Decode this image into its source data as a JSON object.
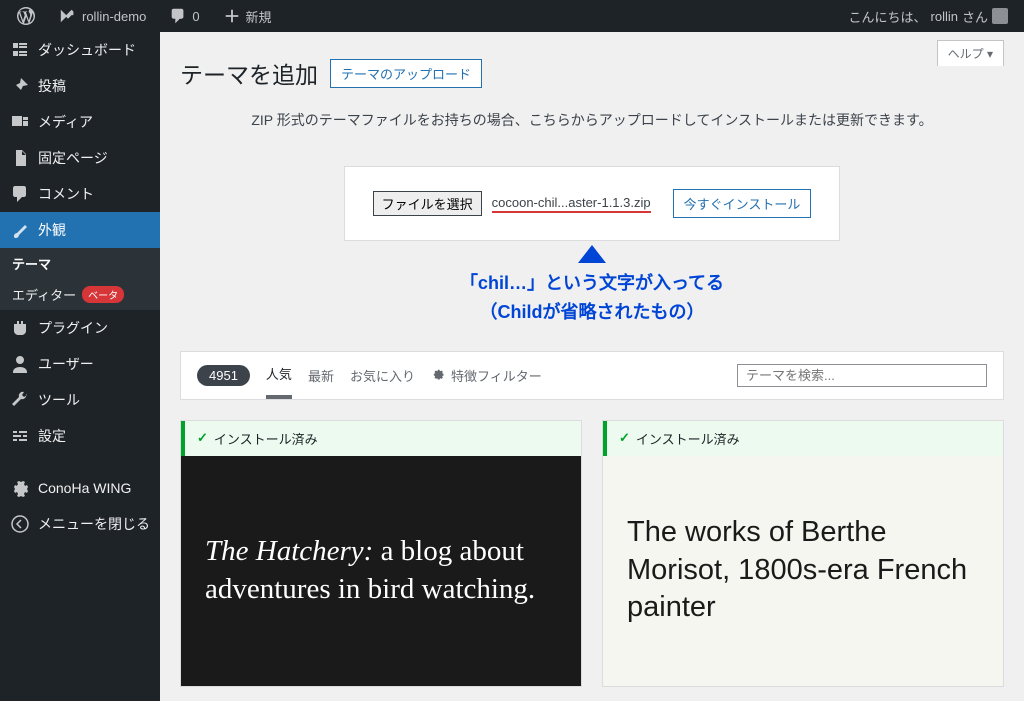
{
  "adminbar": {
    "site_name": "rollin-demo",
    "comment_count": "0",
    "new_label": "新規",
    "greeting": "こんにちは、",
    "username": "rollin",
    "username_suffix": " さん"
  },
  "sidebar": {
    "dashboard": "ダッシュボード",
    "posts": "投稿",
    "media": "メディア",
    "pages": "固定ページ",
    "comments": "コメント",
    "appearance": "外観",
    "themes": "テーマ",
    "editor": "エディター",
    "beta": "ベータ",
    "plugins": "プラグイン",
    "users": "ユーザー",
    "tools": "ツール",
    "settings": "設定",
    "conoha": "ConoHa WING",
    "collapse": "メニューを閉じる"
  },
  "content": {
    "help": "ヘルプ ▾",
    "page_title": "テーマを追加",
    "upload_toggle": "テーマのアップロード",
    "upload_msg": "ZIP 形式のテーマファイルをお持ちの場合、こちらからアップロードしてインストールまたは更新できます。",
    "file_button": "ファイルを選択",
    "selected_file": "cocoon-chil...aster-1.1.3.zip",
    "install_now": "今すぐインストール",
    "annotation_line1": "「chil…」という文字が入ってる",
    "annotation_line2": "（Childが省略されたもの）",
    "count": "4951",
    "filters": {
      "popular": "人気",
      "latest": "最新",
      "favorites": "お気に入り",
      "feature": "特徴フィルター"
    },
    "search_placeholder": "テーマを検索...",
    "installed_label": "インストール済み",
    "theme1_preview_italic": "The Hatchery: ",
    "theme1_preview_rest": "a blog about adventures in bird watching.",
    "theme2_preview": "The works of Berthe Morisot, 1800s-era French painter"
  }
}
